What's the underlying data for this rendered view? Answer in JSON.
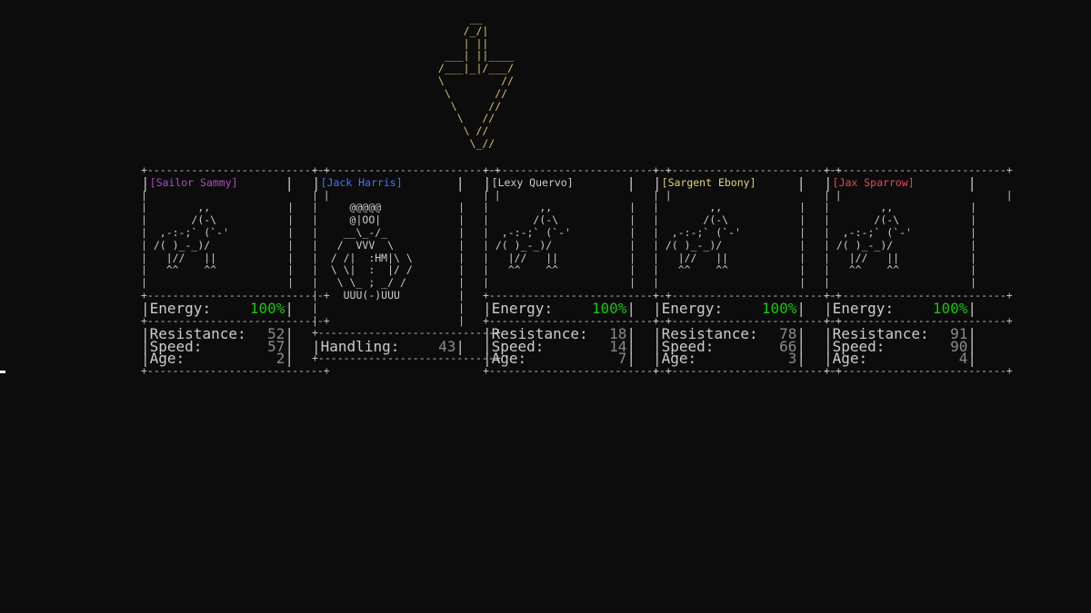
{
  "pointer_art": "      __\n     /_/|\n     | ||\n  ___| ||____\n /___|_|/___/\n \\         //\n  \\       //\n   \\     //\n    \\   //\n     \\ //\n      \\_//",
  "cards": [
    {
      "name": "[Sailor Sammy]",
      "name_color": "#b04cc8",
      "art": "        ,,\n       /(-\\\n  ,-:-;` (`-'\n /( )_-_)/\n   |//   ||\n   ^^    ^^",
      "energy_label": "Energy:",
      "energy_value": "100%",
      "stats": [
        {
          "label": "Resistance:",
          "value": "52"
        },
        {
          "label": "Speed:",
          "value": "57"
        },
        {
          "label": "Age:",
          "value": "2"
        }
      ]
    },
    {
      "name": "[Jack Harris]",
      "name_color": "#3b78ff",
      "art": "     @@@@@\n     @|OO|\n    __\\_-/_\n   /  VVV  \\\n  / /|  :HM|\\ \\\n  \\ \\|  :  |/ /\n   \\ \\_ ; _/ /\n    UUU(-)UUU",
      "stats": [
        {
          "label": "Handling:",
          "value": "43"
        }
      ]
    },
    {
      "name": "[Lexy Quervo]",
      "name_color": "#cccccc",
      "art": "        ,,\n       /(-\\\n  ,-:-;` (`-'\n /( )_-_)/\n   |//   ||\n   ^^    ^^",
      "energy_label": "Energy:",
      "energy_value": "100%",
      "stats": [
        {
          "label": "Resistance:",
          "value": "18"
        },
        {
          "label": "Speed:",
          "value": "14"
        },
        {
          "label": "Age:",
          "value": "7"
        }
      ]
    },
    {
      "name": "[Sargent Ebony]",
      "name_color": "#e8d66e",
      "art": "        ,,\n       /(-\\\n  ,-:-;` (`-'\n /( )_-_)/\n   |//   ||\n   ^^    ^^",
      "energy_label": "Energy:",
      "energy_value": "100%",
      "stats": [
        {
          "label": "Resistance:",
          "value": "78"
        },
        {
          "label": "Speed:",
          "value": "66"
        },
        {
          "label": "Age:",
          "value": "3"
        }
      ]
    },
    {
      "name": "[Jax Sparrow]",
      "name_color": "#e74856",
      "art": "        ,,\n       /(-\\\n  ,-:-;` (`-'\n /( )_-_)/\n   |//   ||\n   ^^    ^^",
      "energy_label": "Energy:",
      "energy_value": "100%",
      "stats": [
        {
          "label": "Resistance:",
          "value": "91"
        },
        {
          "label": "Speed:",
          "value": "90"
        },
        {
          "label": "Age:",
          "value": "4"
        }
      ]
    }
  ]
}
